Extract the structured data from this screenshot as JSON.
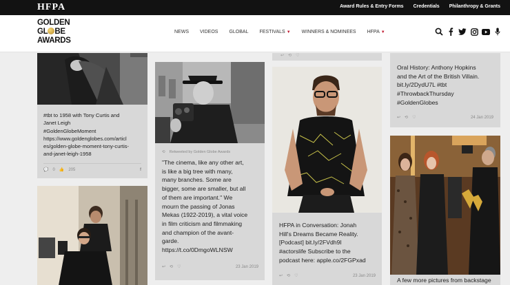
{
  "topbar": {
    "brand": "HFPA",
    "links": [
      "Award Rules & Entry Forms",
      "Credentials",
      "Philanthropy & Grants"
    ]
  },
  "header": {
    "logo_lines": [
      "GOLDEN",
      "GL",
      "BE",
      "AWARDS"
    ],
    "nav": [
      {
        "label": "NEWS",
        "caret": false
      },
      {
        "label": "VIDEOS",
        "caret": false
      },
      {
        "label": "GLOBAL",
        "caret": false
      },
      {
        "label": "FESTIVALS",
        "caret": true
      },
      {
        "label": "WINNERS & NOMINEES",
        "caret": false
      },
      {
        "label": "HFPA",
        "caret": true
      }
    ],
    "icons": [
      "search-icon",
      "facebook-icon",
      "twitter-icon",
      "instagram-icon",
      "youtube-icon",
      "microphone-icon"
    ]
  },
  "feed": {
    "card1": {
      "text_lines": [
        "#tbt to 1958 with Tony Curtis and",
        "Janet Leigh",
        "#GoldenGlobeMoment",
        "https://www.goldenglobes.com/articl",
        "es/golden-globe-moment-tony-curtis-",
        "and-janet-leigh-1958"
      ],
      "comments": "0",
      "likes": "205"
    },
    "card2": {
      "retweet_note": "Retweeted by Golden Globe Awards",
      "text_lines": [
        "\"The cinema, like any other art,",
        "is like a big tree with many,",
        "many branches. Some are",
        "bigger, some are smaller, but all",
        "of them are important.\" We",
        "mourn the passing of Jonas",
        "Mekas (1922-2019), a vital voice",
        "in film criticism and filmmaking",
        "and champion of the avant-",
        "garde.",
        "https://t.co/0DmgoWLNSW"
      ],
      "date": "23 Jan 2019"
    },
    "card3": {
      "text_lines": [
        "HFPA in Conversation: Jonah",
        "Hill's Dreams Became Reality.",
        "[Podcast] bit.ly/2FVdh9I",
        "#actorslife Subscribe to the",
        "podcast here: apple.co/2FGPxad"
      ],
      "date": "23 Jan 2019"
    },
    "card4": {
      "text_lines": [
        "Oral History: Anthony Hopkins",
        "and the Art of the British Villain.",
        "bit.ly/2DydU7L #tbt",
        "#ThrowbackThursday",
        "#GoldenGlobes"
      ],
      "date": "24 Jan 2019"
    },
    "card5": {
      "text_lines": [
        "A few more pictures from backstage"
      ]
    }
  }
}
